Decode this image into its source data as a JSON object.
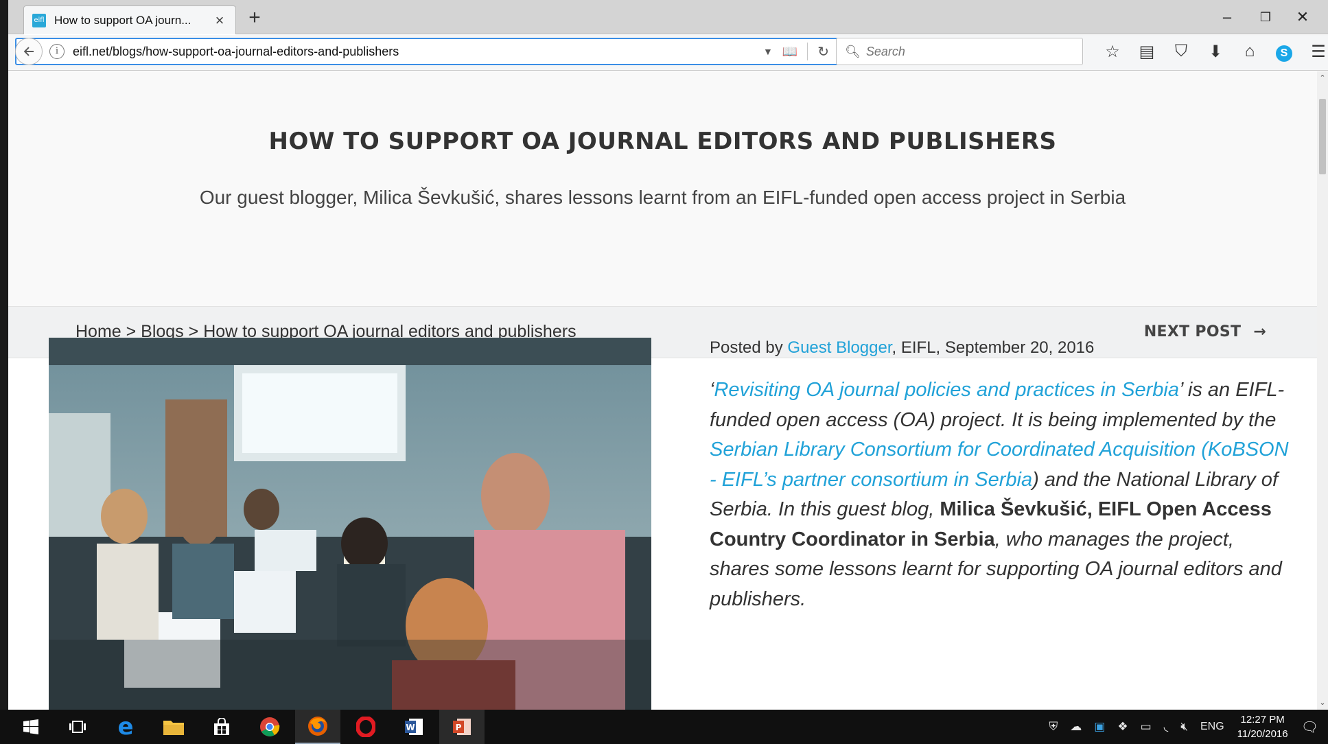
{
  "browser": {
    "tab_title": "How to support OA journ...",
    "favicon_text": "eifl",
    "url": "eifl.net/blogs/how-support-oa-journal-editors-and-publishers",
    "search_placeholder": "Search"
  },
  "page": {
    "title": "HOW TO SUPPORT OA JOURNAL EDITORS AND PUBLISHERS",
    "subtitle": "Our guest blogger, Milica Ševkušić, shares lessons learnt from an EIFL-funded open access project in Serbia",
    "breadcrumb": "Home > Blogs > How to support OA journal editors and publishers",
    "next_post": "NEXT POST",
    "meta": {
      "prefix": "Posted by ",
      "author": "Guest Blogger",
      "suffix": ", EIFL, September 20, 2016"
    },
    "intro": {
      "q_open": "‘",
      "link1": "Revisiting OA journal policies and practices in Serbia",
      "t1": "’ is an EIFL-funded open access (OA) project. It is being implemented by the ",
      "link2": "Serbian Library Consortium for Coordinated Acquisition (KoBSON - EIFL’s partner consortium in Serbia",
      "t2": ") and the National Library of Serbia. In this guest blog, ",
      "bold": "Milica Ševkušić, EIFL Open Access Country Coordinator in Serbia",
      "t3": ", who manages the project, shares some lessons learnt for supporting OA journal editors and publishers."
    }
  },
  "taskbar": {
    "language": "ENG",
    "time": "12:27 PM",
    "date": "11/20/2016"
  },
  "colors": {
    "link": "#21a2d8",
    "taskbar": "#101010",
    "hero_bg": "#f9f9f9"
  }
}
